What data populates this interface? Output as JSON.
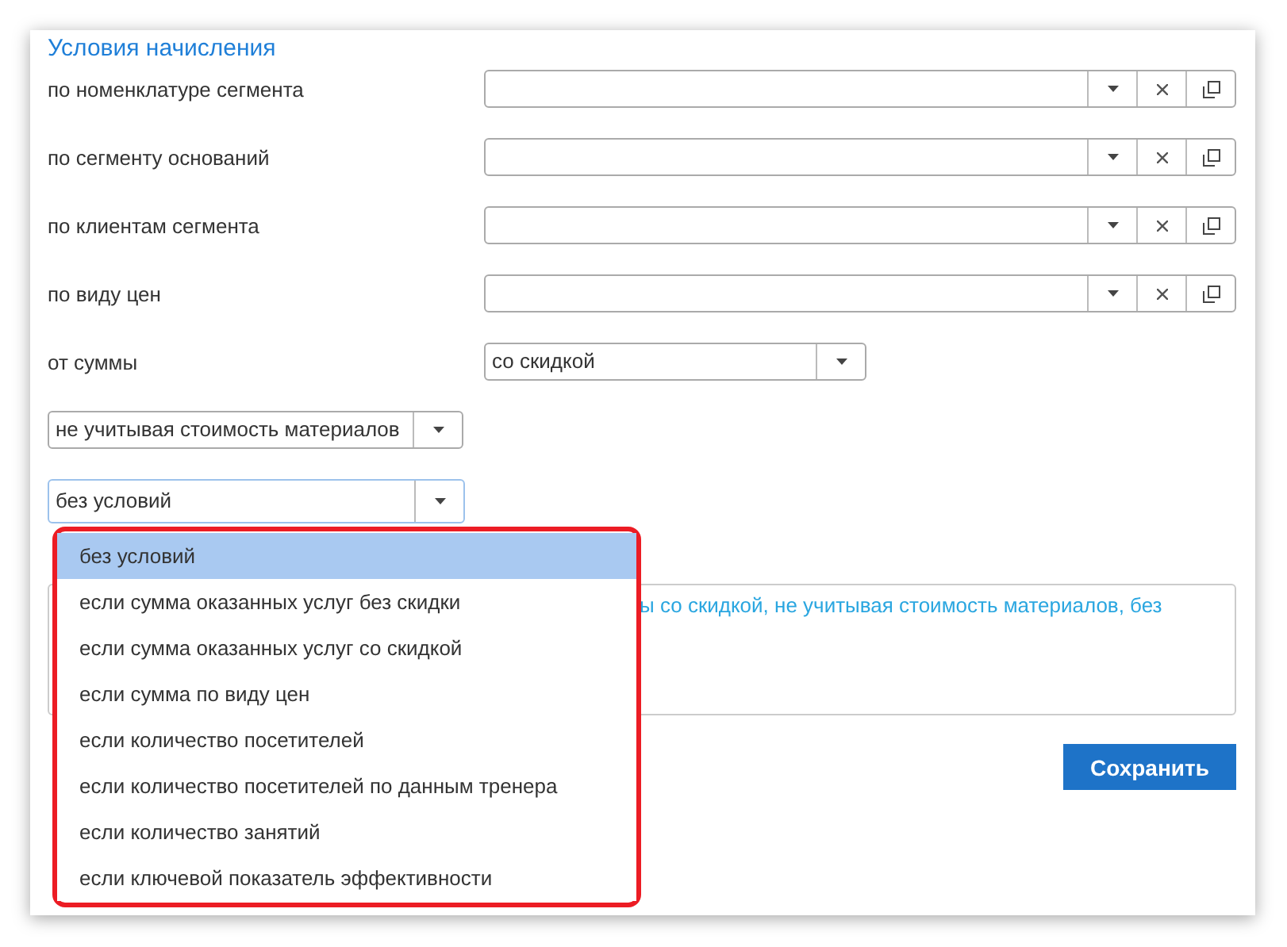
{
  "title": "Условия начисления",
  "lookup_rows": [
    {
      "label": "по номенклатуре сегмента"
    },
    {
      "label": "по сегменту оснований"
    },
    {
      "label": "по клиентам сегмента"
    },
    {
      "label": "по виду цен"
    }
  ],
  "amount_row": {
    "label": "от суммы",
    "value": "со скидкой"
  },
  "materials_select": {
    "value": "не учитывая стоимость материалов"
  },
  "condition_select": {
    "value": "без условий",
    "expanded": true,
    "focused": true,
    "options": [
      {
        "label": "без условий",
        "selected": true
      },
      {
        "label": "если сумма оказанных услуг без скидки",
        "selected": false
      },
      {
        "label": "если сумма оказанных услуг со скидкой",
        "selected": false
      },
      {
        "label": "если сумма по виду цен",
        "selected": false
      },
      {
        "label": "если количество посетителей",
        "selected": false
      },
      {
        "label": "если количество посетителей по данным тренера",
        "selected": false
      },
      {
        "label": "если количество занятий",
        "selected": false
      },
      {
        "label": "если ключевой показатель эффективности",
        "selected": false
      }
    ]
  },
  "summary": "ы со скидкой, не учитывая стоимость материалов, без",
  "save_button": "Сохранить"
}
